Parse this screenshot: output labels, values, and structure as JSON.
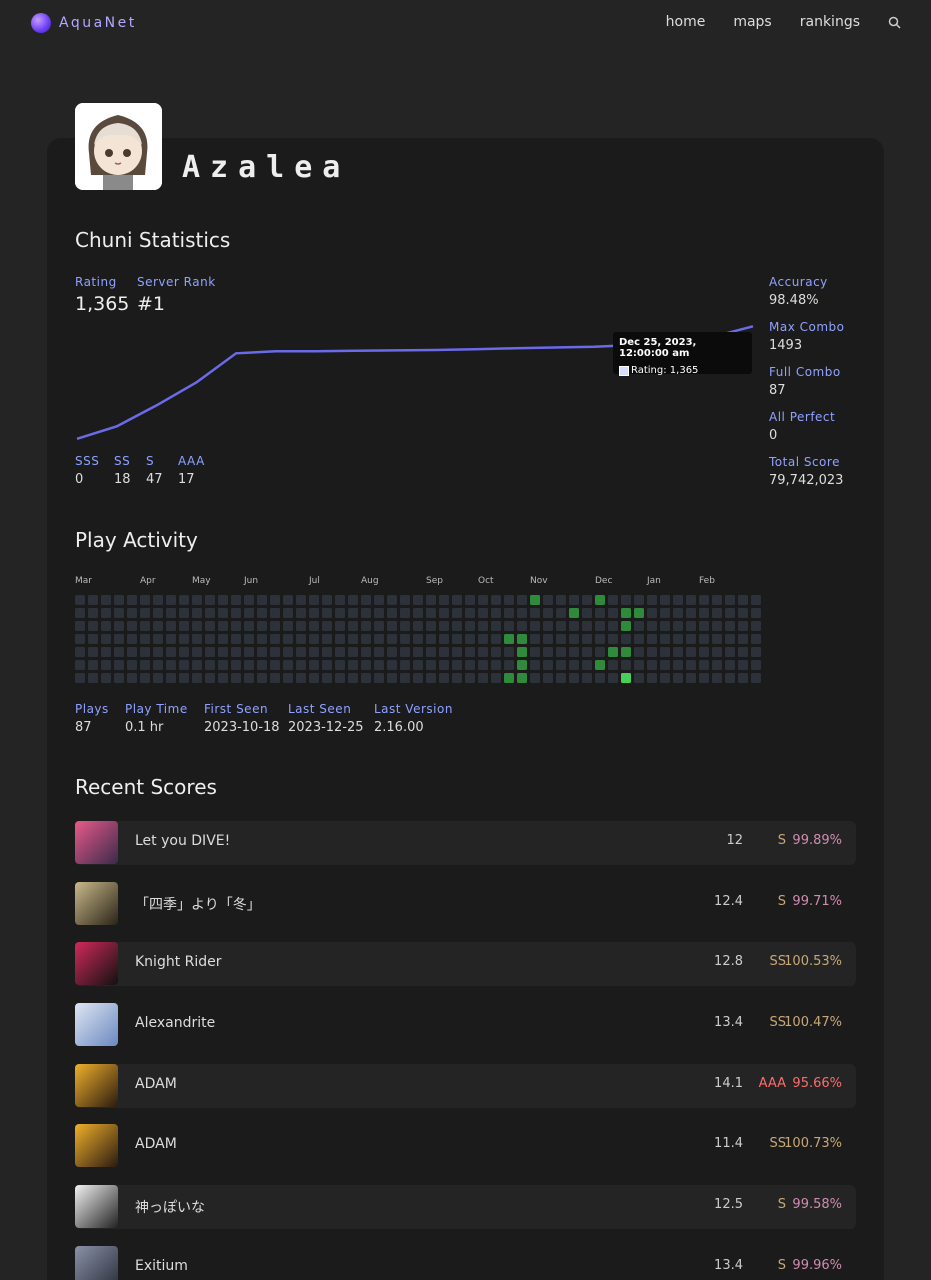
{
  "nav": {
    "brand": "AquaNet",
    "links": [
      "home",
      "maps",
      "rankings"
    ]
  },
  "profile": {
    "username": "Azalea"
  },
  "chuni": {
    "title": "Chuni Statistics",
    "rating_label": "Rating",
    "rating": "1,365",
    "rank_label": "Server Rank",
    "rank": "#1",
    "right": [
      {
        "label": "Accuracy",
        "value": "98.48%"
      },
      {
        "label": "Max Combo",
        "value": "1493"
      },
      {
        "label": "Full Combo",
        "value": "87"
      },
      {
        "label": "All Perfect",
        "value": "0"
      },
      {
        "label": "Total Score",
        "value": "79,742,023"
      }
    ],
    "grades": [
      {
        "label": "SSS",
        "value": "0"
      },
      {
        "label": "SS",
        "value": "18"
      },
      {
        "label": "S",
        "value": "47"
      },
      {
        "label": "AAA",
        "value": "17"
      }
    ],
    "tooltip": {
      "date": "Dec 25, 2023, 12:00:00 am",
      "text": "Rating: 1,365"
    }
  },
  "chart_data": {
    "type": "line",
    "series": [
      {
        "values": [
          1095,
          1125,
          1175,
          1230,
          1300,
          1305,
          1305,
          1306,
          1307,
          1308,
          1310,
          1312,
          1314,
          1316,
          1320,
          1328,
          1340,
          1365
        ]
      }
    ],
    "title": "",
    "xlabel": "",
    "ylabel": "",
    "ylim": [
      1080,
      1380
    ],
    "grid": false,
    "color": "#6b6bea"
  },
  "activity": {
    "title": "Play Activity",
    "months": [
      "Mar",
      "Apr",
      "May",
      "Jun",
      "Jul",
      "Aug",
      "Sep",
      "Oct",
      "Nov",
      "Dec",
      "Jan",
      "Feb"
    ],
    "active": [
      [
        35,
        0
      ],
      [
        40,
        0
      ],
      [
        38,
        1
      ],
      [
        42,
        1
      ],
      [
        43,
        1
      ],
      [
        42,
        2
      ],
      [
        33,
        3
      ],
      [
        34,
        3
      ],
      [
        34,
        4
      ],
      [
        41,
        4
      ],
      [
        42,
        4
      ],
      [
        34,
        5
      ],
      [
        40,
        5
      ],
      [
        33,
        6
      ],
      [
        34,
        6
      ],
      [
        42,
        6
      ]
    ],
    "bright": [
      [
        42,
        6
      ]
    ],
    "colors": {
      "empty": "#2d3139",
      "active": "#2f8a3b",
      "bright": "#46d05a"
    }
  },
  "play_stats": [
    {
      "label": "Plays",
      "value": "87"
    },
    {
      "label": "Play Time",
      "value": "0.1 hr"
    },
    {
      "label": "First Seen",
      "value": "2023-10-18"
    },
    {
      "label": "Last Seen",
      "value": "2023-12-25"
    },
    {
      "label": "Last Version",
      "value": "2.16.00"
    }
  ],
  "recent": {
    "title": "Recent Scores",
    "rows": [
      {
        "name": "Let you DIVE!",
        "level": "12",
        "rank": "S",
        "acc": "99.89%",
        "cover": [
          "#e85a8a",
          "#3a2a4a"
        ]
      },
      {
        "name": "「四季」より「冬」",
        "level": "12.4",
        "rank": "S",
        "acc": "99.71%",
        "cover": [
          "#c9b98a",
          "#2a2418"
        ]
      },
      {
        "name": "Knight Rider",
        "level": "12.8",
        "rank": "SS",
        "acc": "100.53%",
        "cover": [
          "#d02a5a",
          "#111"
        ]
      },
      {
        "name": "Alexandrite",
        "level": "13.4",
        "rank": "SS",
        "acc": "100.47%",
        "cover": [
          "#dfe6f2",
          "#6a88c0"
        ]
      },
      {
        "name": "ADAM",
        "level": "14.1",
        "rank": "AAA",
        "acc": "95.66%",
        "cover": [
          "#f0b02a",
          "#2a1a10"
        ]
      },
      {
        "name": "ADAM",
        "level": "11.4",
        "rank": "SS",
        "acc": "100.73%",
        "cover": [
          "#f0b02a",
          "#2a1a10"
        ]
      },
      {
        "name": "神っぽいな",
        "level": "12.5",
        "rank": "S",
        "acc": "99.58%",
        "cover": [
          "#f2f2f2",
          "#222"
        ]
      },
      {
        "name": "Exitium",
        "level": "13.4",
        "rank": "S",
        "acc": "99.96%",
        "cover": [
          "#8a92a8",
          "#2a2e3a"
        ]
      }
    ],
    "rank_colors": {
      "S": "#c8a878",
      "SS": "#c8a878",
      "AAA": "#ff6b6b"
    },
    "acc_colors": {
      "S": "#d08cb0",
      "SS": "#c8a878",
      "AAA": "#ff6b6b"
    }
  }
}
